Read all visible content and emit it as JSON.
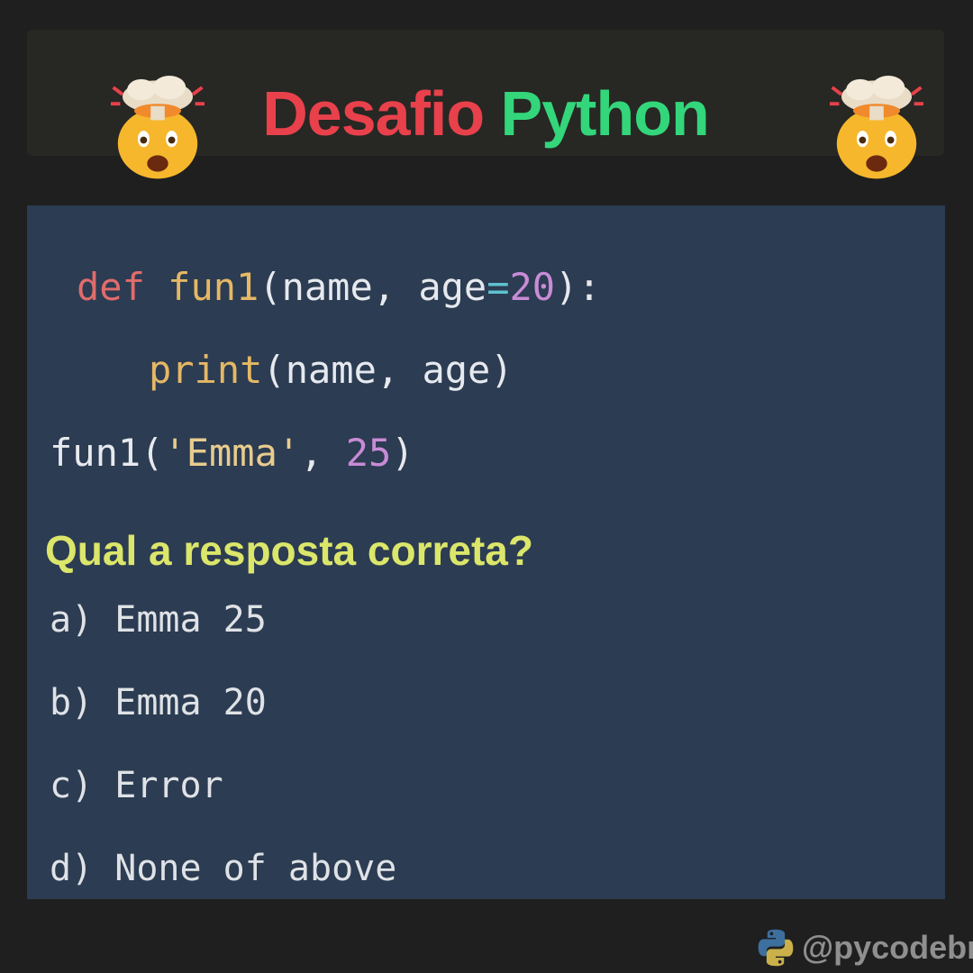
{
  "header": {
    "title_word1": "Desafio",
    "title_word2": "Python",
    "emoji_left": "exploding-head-icon",
    "emoji_right": "exploding-head-icon"
  },
  "code": {
    "line1": {
      "keyword": "def",
      "func": "fun1",
      "open": "(name, age",
      "op": "=",
      "default": "20",
      "close": "):"
    },
    "line2": {
      "func": "print",
      "args": "(name, age)"
    },
    "line3": {
      "func": "fun1(",
      "string": "'Emma'",
      "sep": ", ",
      "arg": "25",
      "close": ")"
    }
  },
  "question": "Qual a resposta correta?",
  "options": [
    "a) Emma 25",
    "b) Emma 20",
    "c) Error",
    "d) None of above"
  ],
  "footer": {
    "handle": "@pycodebr",
    "logo": "python-logo-icon"
  },
  "colors": {
    "background": "#1f1f1f",
    "title_red": "#e8414b",
    "title_green": "#33d67a",
    "code_bg": "#2c3c52",
    "question_yellow": "#dbe66a"
  }
}
